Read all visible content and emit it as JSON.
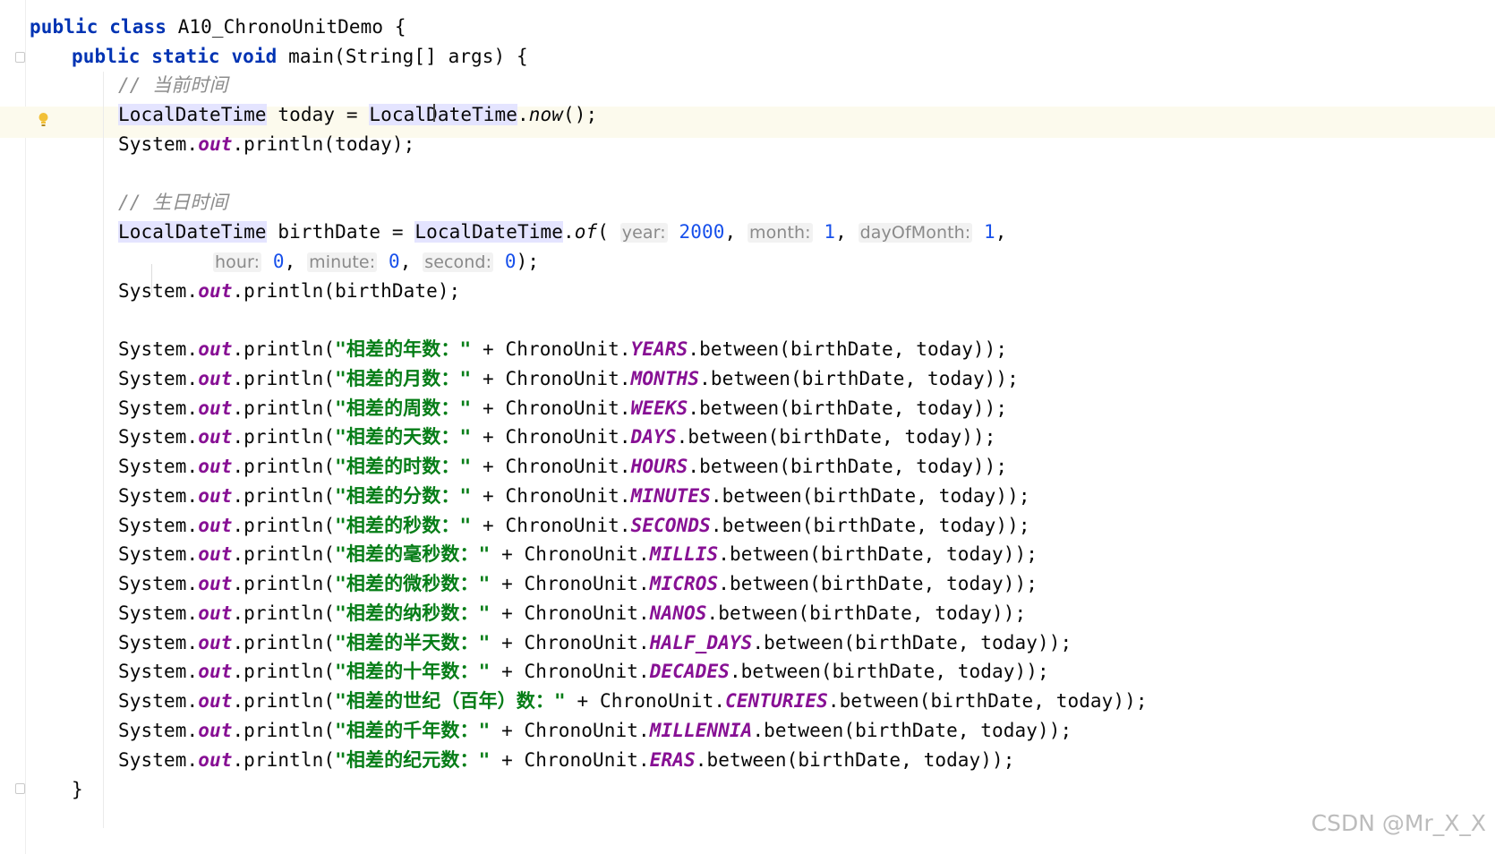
{
  "code": {
    "class_decl": {
      "kw1": "public",
      "kw2": "class",
      "name": "A10_ChronoUnitDemo",
      "brace": "{"
    },
    "main_decl": {
      "kw1": "public",
      "kw2": "static",
      "kw3": "void",
      "sig": "main(String[] args) {"
    },
    "comment_now": "// 当前时间",
    "today_line": {
      "type": "LocalDateTime",
      "var": " today = ",
      "type2": "LocalDateTime",
      "dot": ".",
      "method": "now",
      "rest": "();"
    },
    "print_today": {
      "pre": "System.",
      "out": "out",
      "post": ".println(today);"
    },
    "comment_birth": "// 生日时间",
    "birth_line": {
      "type": "LocalDateTime",
      "var": " birthDate = ",
      "type2": "LocalDateTime",
      "dot": ".",
      "method": "of",
      "open": "(",
      "hint_year": "year:",
      "year": "2000",
      "sep1": ", ",
      "hint_month": "month:",
      "month": "1",
      "sep2": ", ",
      "hint_day": "dayOfMonth:",
      "day": "1",
      "end": ","
    },
    "birth_line2": {
      "hint_hour": "hour:",
      "hour": "0",
      "sep1": ", ",
      "hint_minute": "minute:",
      "minute": "0",
      "sep2": ", ",
      "hint_second": "second:",
      "second": "0",
      "end": ");"
    },
    "print_birth": {
      "pre": "System.",
      "out": "out",
      "post": ".println(birthDate);"
    },
    "println_lines": [
      {
        "pre": "System.",
        "out": "out",
        "mid": ".println(",
        "str": "\"相差的年数：\"",
        "plus": " + ChronoUnit.",
        "unit": "YEARS",
        "post": ".between(birthDate, today));"
      },
      {
        "pre": "System.",
        "out": "out",
        "mid": ".println(",
        "str": "\"相差的月数：\"",
        "plus": " + ChronoUnit.",
        "unit": "MONTHS",
        "post": ".between(birthDate, today));"
      },
      {
        "pre": "System.",
        "out": "out",
        "mid": ".println(",
        "str": "\"相差的周数：\"",
        "plus": " + ChronoUnit.",
        "unit": "WEEKS",
        "post": ".between(birthDate, today));"
      },
      {
        "pre": "System.",
        "out": "out",
        "mid": ".println(",
        "str": "\"相差的天数：\"",
        "plus": " + ChronoUnit.",
        "unit": "DAYS",
        "post": ".between(birthDate, today));"
      },
      {
        "pre": "System.",
        "out": "out",
        "mid": ".println(",
        "str": "\"相差的时数：\"",
        "plus": " + ChronoUnit.",
        "unit": "HOURS",
        "post": ".between(birthDate, today));"
      },
      {
        "pre": "System.",
        "out": "out",
        "mid": ".println(",
        "str": "\"相差的分数：\"",
        "plus": " + ChronoUnit.",
        "unit": "MINUTES",
        "post": ".between(birthDate, today));"
      },
      {
        "pre": "System.",
        "out": "out",
        "mid": ".println(",
        "str": "\"相差的秒数：\"",
        "plus": " + ChronoUnit.",
        "unit": "SECONDS",
        "post": ".between(birthDate, today));"
      },
      {
        "pre": "System.",
        "out": "out",
        "mid": ".println(",
        "str": "\"相差的毫秒数：\"",
        "plus": " + ChronoUnit.",
        "unit": "MILLIS",
        "post": ".between(birthDate, today));"
      },
      {
        "pre": "System.",
        "out": "out",
        "mid": ".println(",
        "str": "\"相差的微秒数：\"",
        "plus": " + ChronoUnit.",
        "unit": "MICROS",
        "post": ".between(birthDate, today));"
      },
      {
        "pre": "System.",
        "out": "out",
        "mid": ".println(",
        "str": "\"相差的纳秒数：\"",
        "plus": " + ChronoUnit.",
        "unit": "NANOS",
        "post": ".between(birthDate, today));"
      },
      {
        "pre": "System.",
        "out": "out",
        "mid": ".println(",
        "str": "\"相差的半天数：\"",
        "plus": " + ChronoUnit.",
        "unit": "HALF_DAYS",
        "post": ".between(birthDate, today));"
      },
      {
        "pre": "System.",
        "out": "out",
        "mid": ".println(",
        "str": "\"相差的十年数：\"",
        "plus": " + ChronoUnit.",
        "unit": "DECADES",
        "post": ".between(birthDate, today));"
      },
      {
        "pre": "System.",
        "out": "out",
        "mid": ".println(",
        "str": "\"相差的世纪（百年）数：\"",
        "plus": " + ChronoUnit.",
        "unit": "CENTURIES",
        "post": ".between(birthDate, today));"
      },
      {
        "pre": "System.",
        "out": "out",
        "mid": ".println(",
        "str": "\"相差的千年数：\"",
        "plus": " + ChronoUnit.",
        "unit": "MILLENNIA",
        "post": ".between(birthDate, today));"
      },
      {
        "pre": "System.",
        "out": "out",
        "mid": ".println(",
        "str": "\"相差的纪元数：\"",
        "plus": " + ChronoUnit.",
        "unit": "ERAS",
        "post": ".between(birthDate, today));"
      }
    ],
    "closing_brace": "}"
  },
  "watermark": "CSDN @Mr_X_X",
  "colors": {
    "keyword": "#0033b3",
    "string": "#067d17",
    "static_field": "#871094",
    "number": "#1750eb",
    "comment": "#8c8c8c",
    "current_line": "#fcfaed"
  },
  "icons": {
    "intention": "lightbulb-icon",
    "fold": "fold-marker-icon"
  }
}
